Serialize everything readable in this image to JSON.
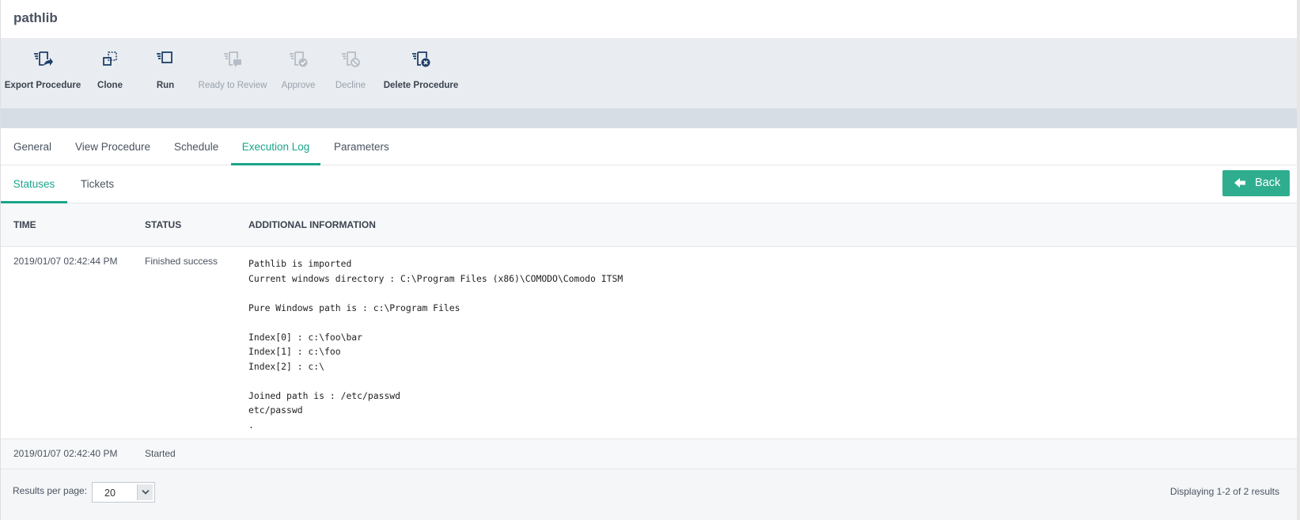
{
  "page": {
    "title": "pathlib"
  },
  "toolbar": {
    "items": [
      {
        "label": "Export Procedure",
        "icon": "export-procedure-icon",
        "enabled": true
      },
      {
        "label": "Clone",
        "icon": "clone-icon",
        "enabled": true
      },
      {
        "label": "Run",
        "icon": "run-icon",
        "enabled": true
      },
      {
        "label": "Ready to Review",
        "icon": "ready-to-review-icon",
        "enabled": false
      },
      {
        "label": "Approve",
        "icon": "approve-icon",
        "enabled": false
      },
      {
        "label": "Decline",
        "icon": "decline-icon",
        "enabled": false
      },
      {
        "label": "Delete Procedure",
        "icon": "delete-procedure-icon",
        "enabled": true
      }
    ]
  },
  "tabs": {
    "items": [
      {
        "label": "General"
      },
      {
        "label": "View Procedure"
      },
      {
        "label": "Schedule"
      },
      {
        "label": "Execution Log"
      },
      {
        "label": "Parameters"
      }
    ],
    "active": "Execution Log"
  },
  "subtabs": {
    "items": [
      {
        "label": "Statuses"
      },
      {
        "label": "Tickets"
      }
    ],
    "active": "Statuses"
  },
  "back_button": {
    "label": "Back",
    "icon": "arrow-left-icon"
  },
  "table": {
    "columns": [
      "TIME",
      "STATUS",
      "ADDITIONAL INFORMATION"
    ],
    "rows": [
      {
        "time": "2019/01/07 02:42:44 PM",
        "status": "Finished success",
        "info": [
          "Pathlib is imported",
          "Current windows directory : C:\\Program Files (x86)\\COMODO\\Comodo ITSM",
          "",
          "Pure Windows path is : c:\\Program Files",
          "",
          "Index[0] : c:\\foo\\bar",
          "Index[1] : c:\\foo",
          "Index[2] : c:\\",
          "",
          "Joined path is : /etc/passwd",
          "etc/passwd",
          "."
        ]
      },
      {
        "time": "2019/01/07 02:42:40 PM",
        "status": "Started",
        "info": []
      }
    ]
  },
  "footer": {
    "results_per_page_label": "Results per page:",
    "results_per_page_value": "20",
    "displaying": "Displaying 1-2 of 2 results"
  },
  "colors": {
    "accent": "#1aa58a",
    "back_button": "#2fae8f",
    "toolbar_bg": "#e9ecf0",
    "icon": "#1f3f6a",
    "icon_disabled": "#b5bdc6"
  }
}
